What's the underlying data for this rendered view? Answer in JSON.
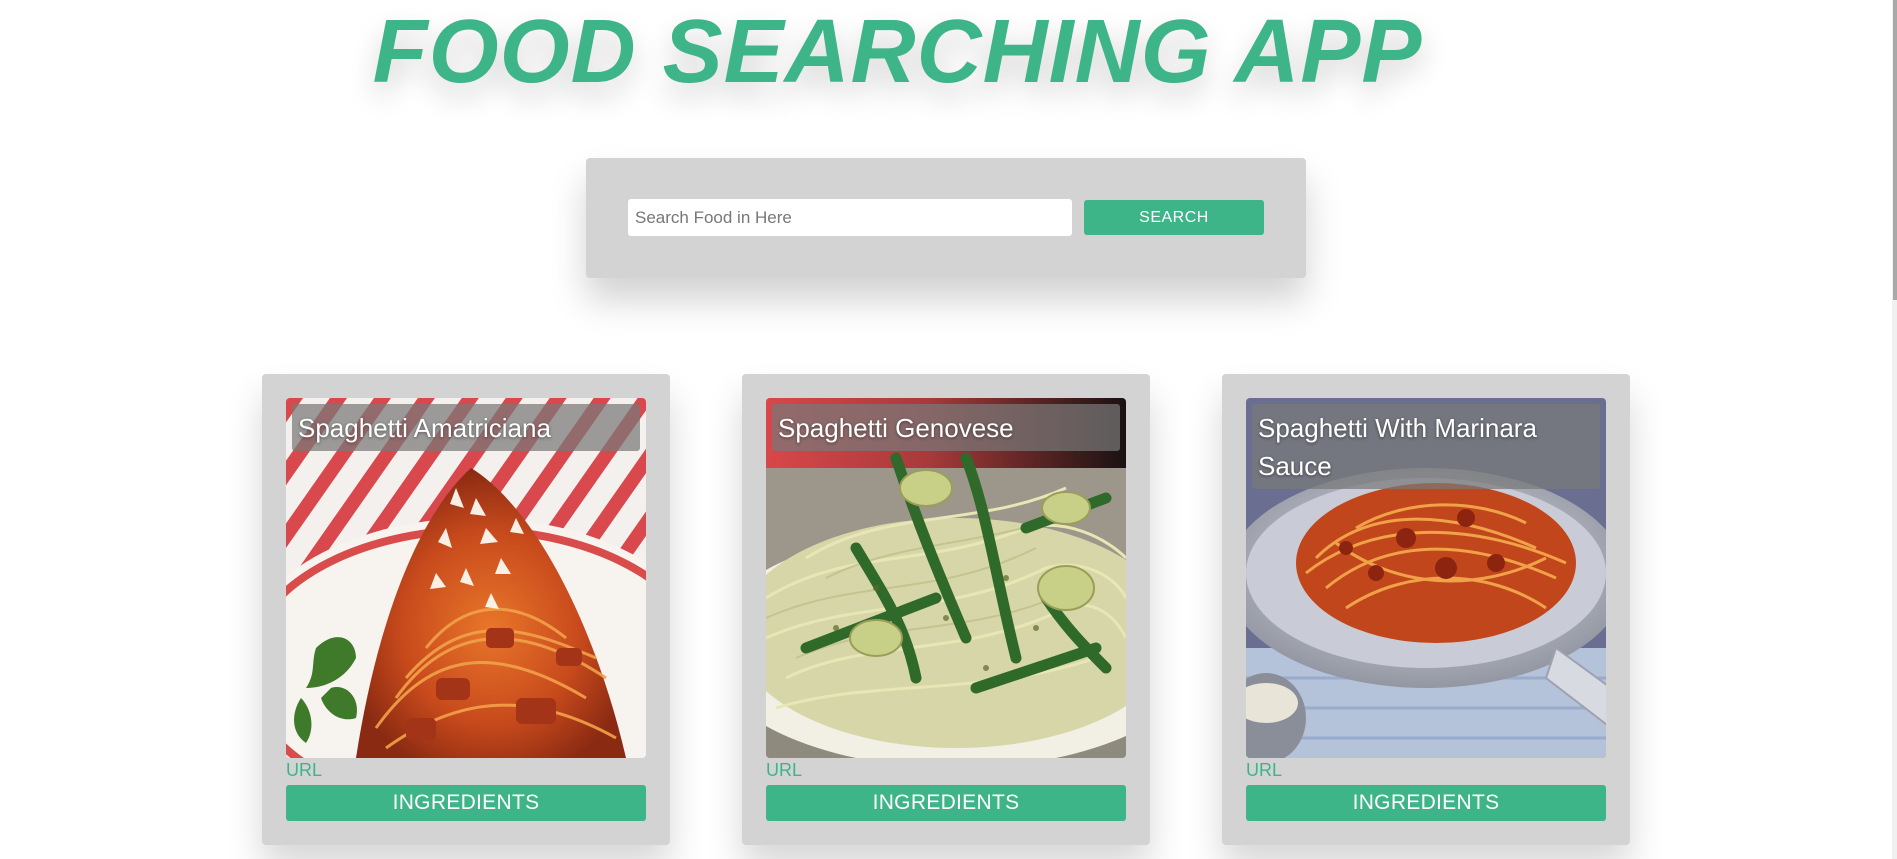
{
  "app": {
    "title": "FOOD SEARCHING APP"
  },
  "search": {
    "placeholder": "Search Food in Here",
    "value": "",
    "button_label": "SEARCH"
  },
  "colors": {
    "accent": "#3eb489",
    "panel": "#d3d3d3",
    "background": "#ffffff"
  },
  "results": [
    {
      "title": "Spaghetti Amatriciana",
      "url_label": "URL",
      "ingredients_label": "INGREDIENTS",
      "image_icon": "spaghetti-amatriciana-photo"
    },
    {
      "title": "Spaghetti Genovese",
      "url_label": "URL",
      "ingredients_label": "INGREDIENTS",
      "image_icon": "spaghetti-genovese-photo"
    },
    {
      "title": "Spaghetti With Marinara Sauce",
      "url_label": "URL",
      "ingredients_label": "INGREDIENTS",
      "image_icon": "spaghetti-marinara-photo"
    }
  ]
}
